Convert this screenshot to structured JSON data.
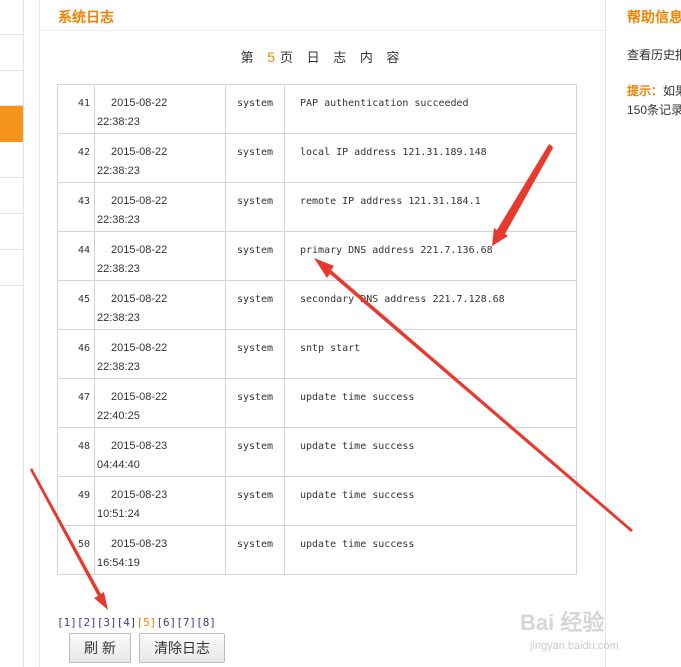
{
  "section_title": "系统日志",
  "heading": {
    "prefix": "第 ",
    "page": "5",
    "suffix": "页 日 志 内 容"
  },
  "log_rows": [
    {
      "no": "41",
      "date": "2015-08-22",
      "time": "22:38:23",
      "source": "system",
      "message": "PAP authentication succeeded"
    },
    {
      "no": "42",
      "date": "2015-08-22",
      "time": "22:38:23",
      "source": "system",
      "message": "local IP address 121.31.189.148"
    },
    {
      "no": "43",
      "date": "2015-08-22",
      "time": "22:38:23",
      "source": "system",
      "message": "remote IP address 121.31.184.1"
    },
    {
      "no": "44",
      "date": "2015-08-22",
      "time": "22:38:23",
      "source": "system",
      "message": "primary DNS address 221.7.136.68"
    },
    {
      "no": "45",
      "date": "2015-08-22",
      "time": "22:38:23",
      "source": "system",
      "message": "secondary DNS address 221.7.128.68"
    },
    {
      "no": "46",
      "date": "2015-08-22",
      "time": "22:38:23",
      "source": "system",
      "message": "sntp start"
    },
    {
      "no": "47",
      "date": "2015-08-22",
      "time": "22:40:25",
      "source": "system",
      "message": "update time success"
    },
    {
      "no": "48",
      "date": "2015-08-23",
      "time": "04:44:40",
      "source": "system",
      "message": "update time success"
    },
    {
      "no": "49",
      "date": "2015-08-23",
      "time": "10:51:24",
      "source": "system",
      "message": "update time success"
    },
    {
      "no": "50",
      "date": "2015-08-23",
      "time": "16:54:19",
      "source": "system",
      "message": "update time success"
    }
  ],
  "pager": [
    "[1]",
    "[2]",
    "[3]",
    "[4]",
    "[5]",
    "[6]",
    "[7]",
    "[8]"
  ],
  "current_page_index": 4,
  "buttons": {
    "refresh": "刷 新",
    "clear": "清除日志"
  },
  "help": {
    "title": "帮助信息",
    "text": "查看历史报",
    "tip_label": "提示：",
    "tip_text": "如果",
    "tip_text2": "150条记录"
  },
  "watermark": {
    "logo": "Bai  经验",
    "url": "jingyan.baidu.com"
  },
  "colors": {
    "accent": "#f08300",
    "arrow": "#e8392e",
    "link": "#3d3d8c"
  }
}
